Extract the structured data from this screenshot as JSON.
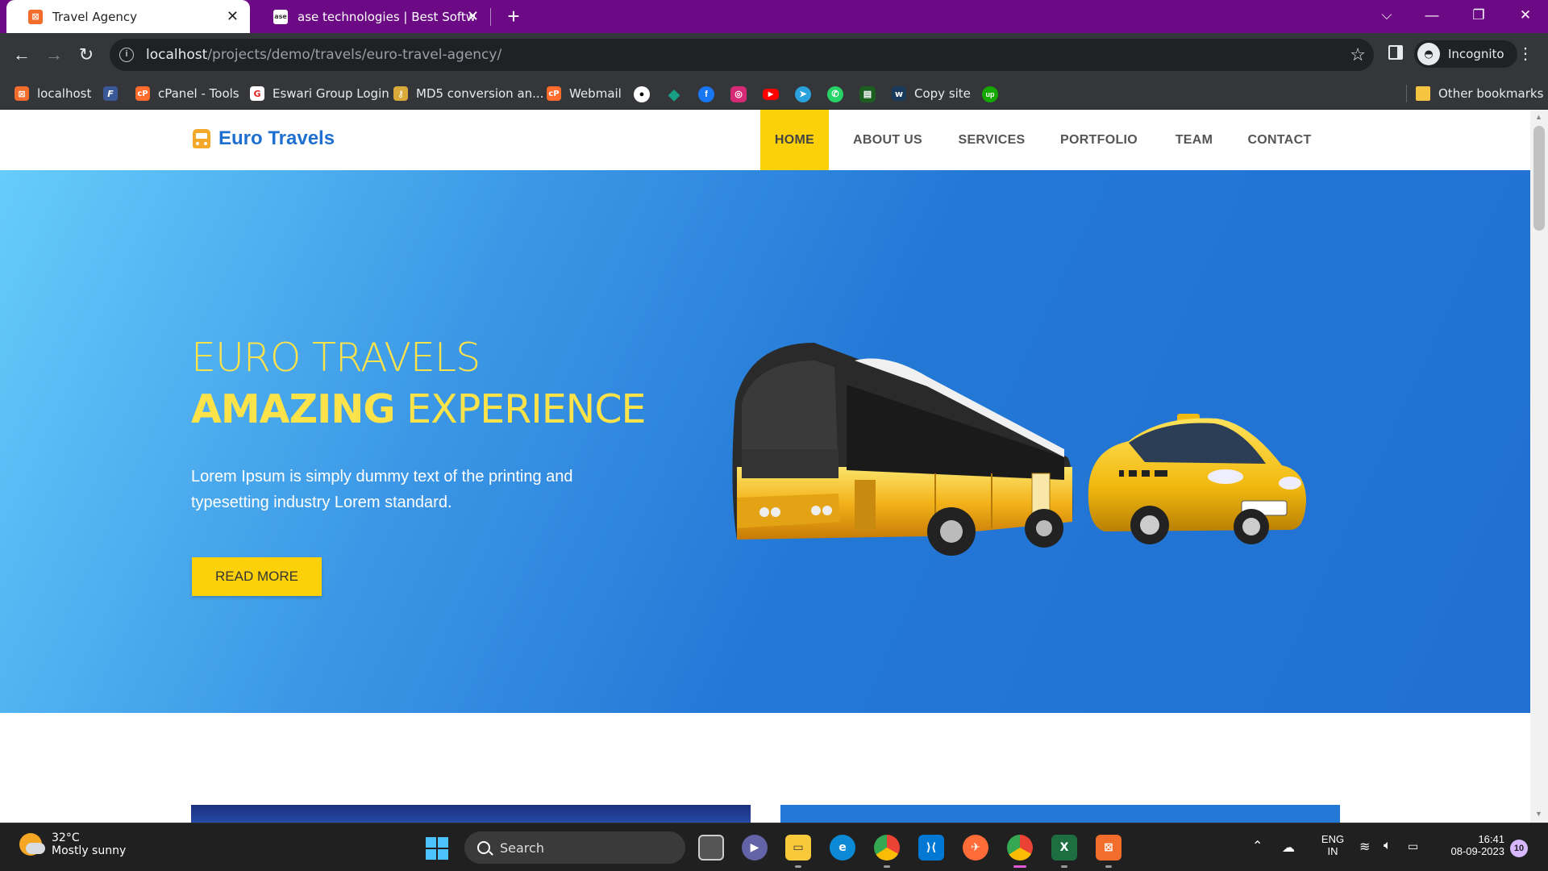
{
  "browser": {
    "tabs": [
      {
        "title": "Travel Agency",
        "favicon": "xampp-icon"
      },
      {
        "title": "ase technologies | Best Software",
        "favicon": "ase-icon"
      }
    ],
    "url": {
      "host": "localhost",
      "path": "/projects/demo/travels/euro-travel-agency/"
    },
    "incognito_label": "Incognito",
    "bookmarks": [
      {
        "label": "localhost",
        "icon": "xampp-icon"
      },
      {
        "label": "",
        "icon": "f-icon"
      },
      {
        "label": "cPanel - Tools",
        "icon": "cpanel-icon"
      },
      {
        "label": "Eswari Group Login",
        "icon": "eswari-icon"
      },
      {
        "label": "MD5 conversion an...",
        "icon": "key-icon"
      },
      {
        "label": "Webmail",
        "icon": "cpanel-icon"
      },
      {
        "label": "Copy site",
        "icon": "w-icon"
      }
    ],
    "icon_bookmarks": [
      "github-icon",
      "diamond-icon",
      "facebook-icon",
      "instagram-icon",
      "youtube-icon",
      "telegram-icon",
      "whatsapp-icon",
      "sheet-icon",
      "upwork-icon"
    ],
    "other_bookmarks": "Other bookmarks"
  },
  "site": {
    "brand": "Euro Travels",
    "nav": [
      {
        "label": "HOME",
        "active": true
      },
      {
        "label": "ABOUT US",
        "active": false
      },
      {
        "label": "SERVICES",
        "active": false
      },
      {
        "label": "PORTFOLIO",
        "active": false
      },
      {
        "label": "TEAM",
        "active": false
      },
      {
        "label": "CONTACT",
        "active": false
      }
    ],
    "hero": {
      "line1": "EURO TRAVELS",
      "line2_bold": "AMAZING",
      "line2_rest": " EXPERIENCE",
      "description": "Lorem Ipsum is simply dummy text of the printing and typesetting industry Lorem standard.",
      "button": "READ MORE",
      "image": "bus-and-taxi-illustration"
    }
  },
  "taskbar": {
    "weather": {
      "temp": "32°C",
      "condition": "Mostly sunny"
    },
    "search_placeholder": "Search",
    "apps": [
      "task-view-icon",
      "teams-icon",
      "file-explorer-icon",
      "edge-icon",
      "chrome-icon",
      "vscode-icon",
      "postman-icon",
      "chrome-incognito-icon",
      "excel-icon",
      "xampp-icon"
    ],
    "language": {
      "line1": "ENG",
      "line2": "IN"
    },
    "time": "16:41",
    "date": "08-09-2023",
    "notifications": "10"
  },
  "colors": {
    "tabbar": "#6b0a84",
    "brand_blue": "#1f6fd0",
    "accent_yellow": "#fdd10a",
    "hero_title": "#fde34a",
    "hero_blue": "#2378d6"
  }
}
